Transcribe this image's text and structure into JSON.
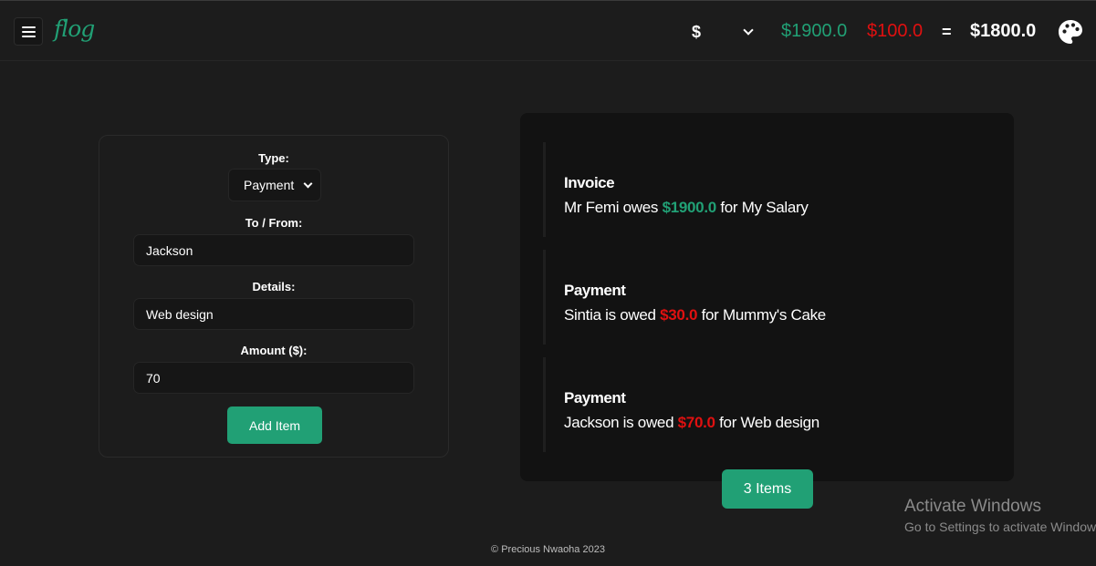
{
  "header": {
    "logo": "flog",
    "currency": "$",
    "income": "$1900.0",
    "expense": "$100.0",
    "equals": "=",
    "balance": "$1800.0",
    "colors": {
      "accent": "#21a075",
      "expense": "#e01010",
      "background": "#1c1c1c"
    }
  },
  "form": {
    "type_label": "Type:",
    "type_value": "Payment",
    "tofrom_label": "To / From:",
    "tofrom_value": "Jackson",
    "details_label": "Details:",
    "details_value": "Web design",
    "amount_label": "Amount ($):",
    "amount_value": "70",
    "submit_label": "Add Item"
  },
  "list": {
    "items": [
      {
        "type": "Invoice",
        "pre": "Mr Femi owes ",
        "amount": "$1900.0",
        "post": " for My Salary"
      },
      {
        "type": "Payment",
        "pre": "Sintia is owed ",
        "amount": "$30.0",
        "post": " for Mummy's Cake"
      },
      {
        "type": "Payment",
        "pre": "Jackson is owed ",
        "amount": "$70.0",
        "post": " for Web design"
      }
    ],
    "count_label": "3 Items"
  },
  "footer": {
    "text": "© Precious Nwaoha 2023"
  },
  "watermark": {
    "title": "Activate Windows",
    "subtitle": "Go to Settings to activate Windows."
  }
}
